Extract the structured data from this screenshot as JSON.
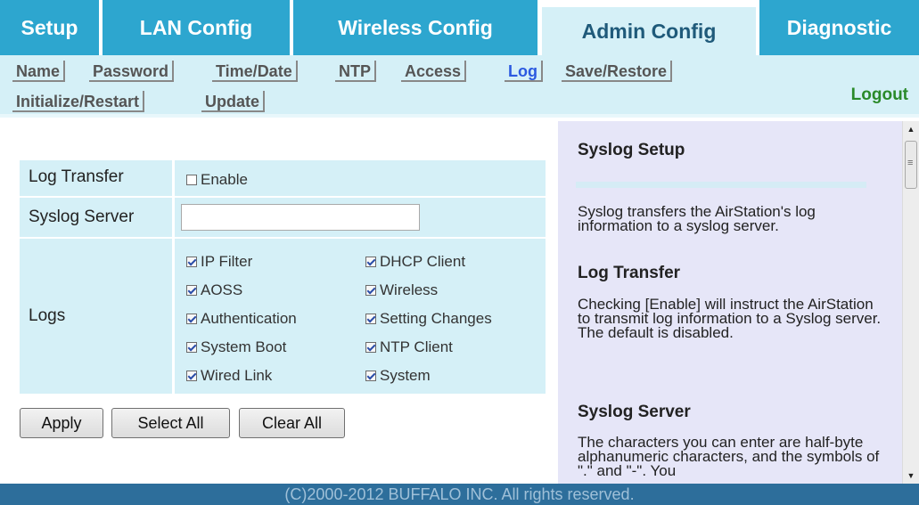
{
  "top_tabs": [
    {
      "label": "Setup",
      "active": false
    },
    {
      "label": "LAN Config",
      "active": false
    },
    {
      "label": "Wireless Config",
      "active": false
    },
    {
      "label": "Admin Config",
      "active": true
    },
    {
      "label": "Diagnostic",
      "active": false
    }
  ],
  "sub_nav": {
    "items": [
      "Name",
      "Password",
      "Time/Date",
      "NTP",
      "Access",
      "Log",
      "Save/Restore",
      "Initialize/Restart",
      "Update"
    ],
    "active": "Log",
    "logout_label": "Logout"
  },
  "form": {
    "log_transfer": {
      "label": "Log Transfer",
      "checkbox_label": "Enable",
      "checked": false
    },
    "syslog_server": {
      "label": "Syslog Server",
      "value": ""
    },
    "logs": {
      "label": "Logs",
      "options": [
        {
          "label": "IP Filter",
          "checked": true
        },
        {
          "label": "DHCP Client",
          "checked": true
        },
        {
          "label": "AOSS",
          "checked": true
        },
        {
          "label": "Wireless",
          "checked": true
        },
        {
          "label": "Authentication",
          "checked": true
        },
        {
          "label": "Setting Changes",
          "checked": true
        },
        {
          "label": "System Boot",
          "checked": true
        },
        {
          "label": "NTP Client",
          "checked": true
        },
        {
          "label": "Wired Link",
          "checked": true
        },
        {
          "label": "System",
          "checked": true
        }
      ]
    }
  },
  "buttons": {
    "apply": "Apply",
    "select_all": "Select All",
    "clear_all": "Clear All"
  },
  "help": {
    "title": "Syslog Setup",
    "intro": "Syslog transfers the AirStation's log information to a syslog server.",
    "log_transfer_title": "Log Transfer",
    "log_transfer_text": "Checking [Enable] will instruct the AirStation to transmit log information to a Syslog server. The default is disabled.",
    "syslog_server_title": "Syslog Server",
    "syslog_server_text": "The characters you can enter are half-byte alphanumeric characters, and the symbols of \".\" and \"-\". You"
  },
  "footer": "(C)2000-2012 BUFFALO INC. All rights reserved."
}
